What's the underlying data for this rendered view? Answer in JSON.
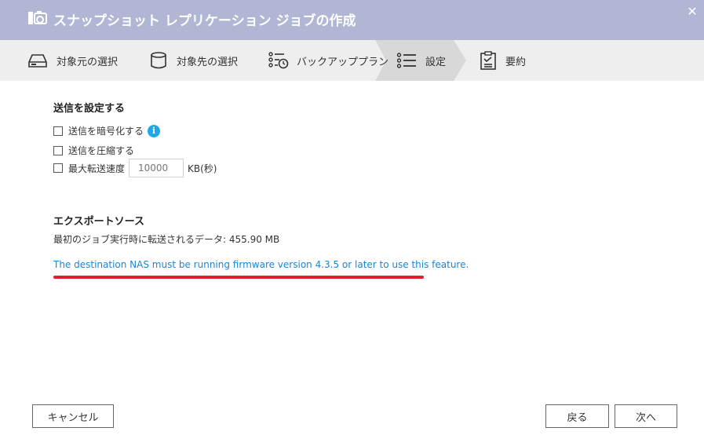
{
  "window": {
    "title": "スナップショット レプリケーション ジョブの作成",
    "close_symbol": "✕"
  },
  "steps": [
    {
      "label": "対象元の選択",
      "icon": "hdd-icon"
    },
    {
      "label": "対象先の選択",
      "icon": "database-icon"
    },
    {
      "label": "バックアッププラン",
      "icon": "schedule-list-icon"
    },
    {
      "label": "設定",
      "icon": "list-icon"
    },
    {
      "label": "要約",
      "icon": "clipboard-icon"
    }
  ],
  "active_step": 3,
  "transfer": {
    "title": "送信を設定する",
    "encrypt_label": "送信を暗号化する",
    "compress_label": "送信を圧縮する",
    "max_speed_label": "最大転送速度",
    "max_speed_placeholder": "10000",
    "unit": "KB(秒)",
    "info_glyph": "i"
  },
  "export": {
    "title": "エクスポートソース",
    "data_text": "最初のジョブ実行時に転送されるデータ: 455.90 MB",
    "note": "The destination NAS must be running firmware version 4.3.5 or later to use this feature."
  },
  "buttons": {
    "cancel": "キャンセル",
    "back": "戻る",
    "next": "次へ"
  },
  "colors": {
    "titlebar": "#b0b6d3",
    "stepbar": "#eeeeee",
    "active_step": "#d8d8d8",
    "link": "#1a86d0",
    "highlight": "#e0202a",
    "info": "#1ea7e9"
  }
}
